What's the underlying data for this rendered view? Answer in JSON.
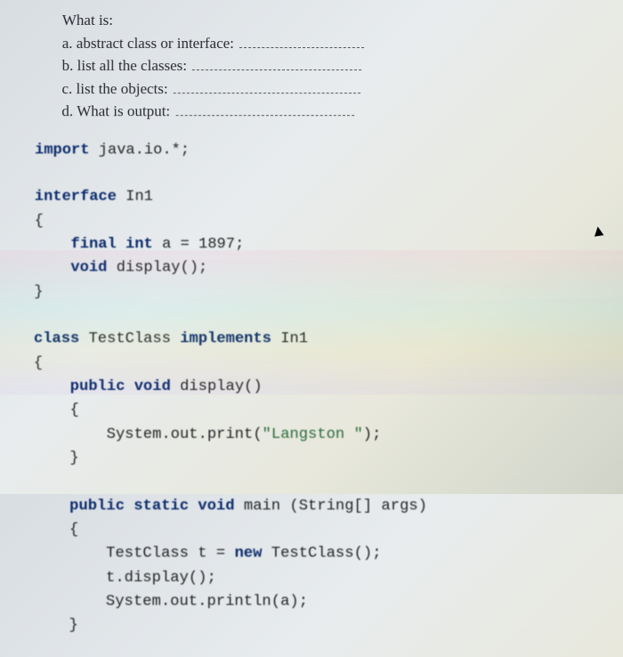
{
  "questions": {
    "heading": "What is:",
    "a": "a. abstract class or interface:",
    "b": "b. list all the classes:",
    "c": "c. list the objects:",
    "d": "d. What is output:"
  },
  "code": {
    "l1a": "import",
    "l1b": " java.io.*;",
    "l2a": "interface",
    "l2b": " In1",
    "l3": "{",
    "l4a": "    final int",
    "l4b": " a = 1897;",
    "l5a": "    void",
    "l5b": " display();",
    "l6": "}",
    "l7a": "class",
    "l7b": " TestClass ",
    "l7c": "implements",
    "l7d": " In1",
    "l8": "{",
    "l9a": "    public void",
    "l9b": " display()",
    "l10": "    {",
    "l11a": "        System.out.print(",
    "l11b": "\"Langston \"",
    "l11c": ");",
    "l12": "    }",
    "l13a": "    public static void",
    "l13b": " main (String[] args)",
    "l14": "    {",
    "l15a": "        TestClass t = ",
    "l15b": "new",
    "l15c": " TestClass();",
    "l16": "        t.display();",
    "l17": "        System.out.println(a);",
    "l18": "    }"
  },
  "cursor_glyph": "▲"
}
